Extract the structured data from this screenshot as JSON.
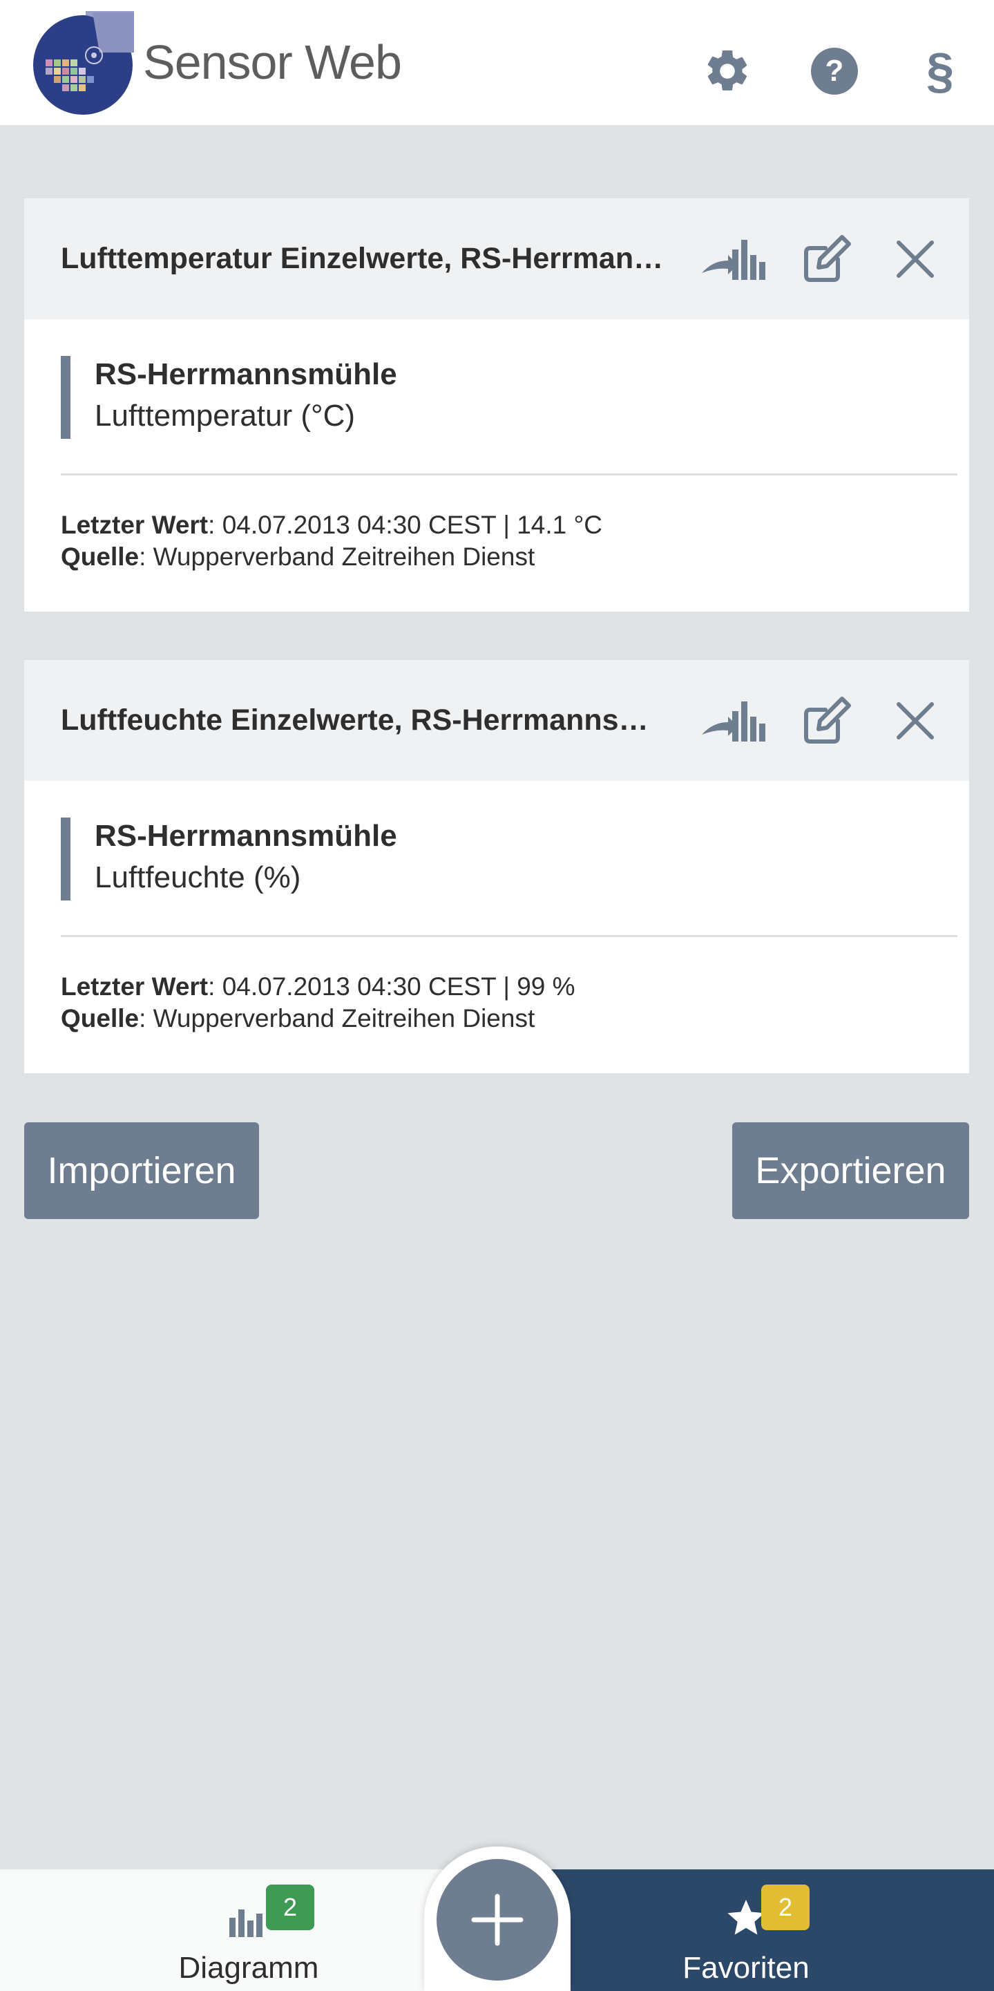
{
  "header": {
    "brand": "Sensor Web",
    "icons": [
      "gear-icon",
      "help-icon",
      "legal-icon"
    ],
    "help_glyph": "?",
    "legal_glyph": "§"
  },
  "timeseries": [
    {
      "title": "Lufttemperatur Einzelwerte, RS-Herrmannsmühle",
      "station": "RS-Herrmannsmühle",
      "phenomenon": "Lufttemperatur (°C)",
      "last_value_label": "Letzter Wert",
      "last_value": ": 04.07.2013 04:30 CEST | 14.1 °C",
      "source_label": "Quelle",
      "source": ": Wupperverband Zeitreihen Dienst",
      "color": "#6f7d91"
    },
    {
      "title": "Luftfeuchte Einzelwerte, RS-Herrmannsmühle",
      "station": "RS-Herrmannsmühle",
      "phenomenon": "Luftfeuchte (%)",
      "last_value_label": "Letzter Wert",
      "last_value": ": 04.07.2013 04:30 CEST | 99 %",
      "source_label": "Quelle",
      "source": ": Wupperverband Zeitreihen Dienst",
      "color": "#6f7d91"
    }
  ],
  "actions": {
    "import_label": "Importieren",
    "export_label": "Exportieren"
  },
  "bottom_nav": {
    "diagram_label": "Diagramm",
    "diagram_count": "2",
    "favorites_label": "Favoriten",
    "favorites_count": "2"
  },
  "colors": {
    "background": "#dfe3e6",
    "accent": "#6f7d91",
    "nav_dark": "#2c4868",
    "badge_green": "#3f9b54",
    "badge_yellow": "#e3bd33"
  }
}
